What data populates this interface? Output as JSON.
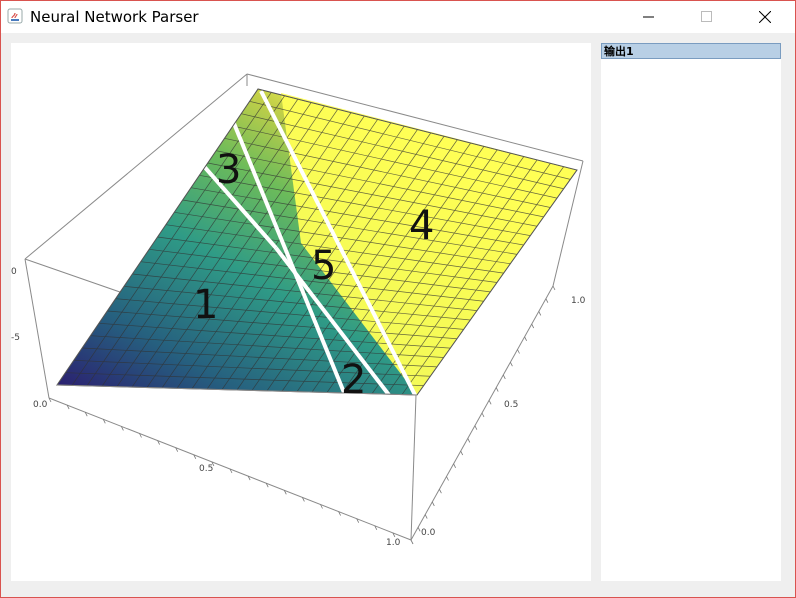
{
  "window": {
    "title": "Neural Network Parser",
    "controls": {
      "minimize": "minimize",
      "maximize": "maximize",
      "close": "close"
    }
  },
  "output_panel": {
    "items": [
      {
        "label": "输出1",
        "selected": true
      }
    ]
  },
  "plot": {
    "region_labels": [
      "1",
      "2",
      "3",
      "4",
      "5"
    ],
    "z_axis_ticks": [
      "0",
      "-5"
    ],
    "x_axis_ticks": [
      "0.0",
      "0.5",
      "1.0"
    ],
    "y_axis_ticks": [
      "0.0",
      "0.5",
      "1.0"
    ],
    "colors": {
      "low": "#2b1a6f",
      "mid": "#2f9b86",
      "high": "#ffff55",
      "region_border": "#ffffff",
      "mesh": "#333333"
    }
  }
}
